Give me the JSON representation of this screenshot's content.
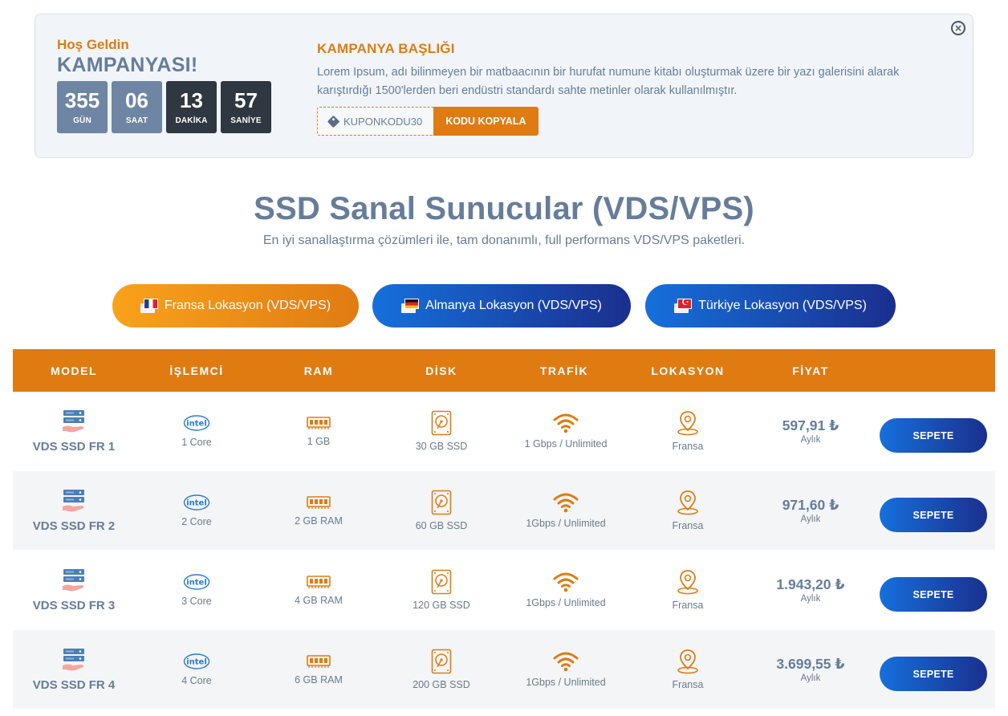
{
  "banner": {
    "hello": "Hoş Geldin",
    "campaign_word": "KAMPANYASI!",
    "countdown": [
      {
        "value": "355",
        "label": "GÜN"
      },
      {
        "value": "06",
        "label": "SAAT"
      },
      {
        "value": "13",
        "label": "DAKİKA"
      },
      {
        "value": "57",
        "label": "SANİYE"
      }
    ],
    "title": "KAMPANYA BAŞLIĞI",
    "description": "Lorem Ipsum, adı bilinmeyen bir matbaacının bir hurufat numune kitabı oluşturmak üzere bir yazı galerisini alarak karıştırdığı 1500'lerden beri endüstri standardı sahte metinler olarak kullanılmıştır.",
    "coupon_code": "KUPONKODU30",
    "copy_button": "KODU KOPYALA",
    "close_glyph": "×"
  },
  "heading": {
    "title": "SSD Sanal Sunucular (VDS/VPS)",
    "subtitle": "En iyi sanallaştırma çözümleri ile, tam donanımlı, full performans VDS/VPS paketleri."
  },
  "tabs": [
    {
      "label": "Fransa Lokasyon (VDS/VPS)",
      "active": true
    },
    {
      "label": "Almanya Lokasyon (VDS/VPS)",
      "active": false
    },
    {
      "label": "Türkiye Lokasyon (VDS/VPS)",
      "active": false
    }
  ],
  "table": {
    "headers": [
      "MODEL",
      "İŞLEMCİ",
      "RAM",
      "DİSK",
      "TRAFİK",
      "LOKASYON",
      "FİYAT"
    ],
    "rows": [
      {
        "model": "VDS SSD FR 1",
        "cpu": "1 Core",
        "ram": "1 GB",
        "disk": "30 GB SSD",
        "traffic": "1 Gbps / Unlimited",
        "location": "Fransa",
        "price": "597,91 ₺",
        "period": "Aylık",
        "button": "SEPETE"
      },
      {
        "model": "VDS SSD FR 2",
        "cpu": "2 Core",
        "ram": "2 GB RAM",
        "disk": "60 GB SSD",
        "traffic": "1Gbps / Unlimited",
        "location": "Fransa",
        "price": "971,60 ₺",
        "period": "Aylık",
        "button": "SEPETE"
      },
      {
        "model": "VDS SSD FR 3",
        "cpu": "3 Core",
        "ram": "4 GB RAM",
        "disk": "120 GB SSD",
        "traffic": "1Gbps / Unlimited",
        "location": "Fransa",
        "price": "1.943,20 ₺",
        "period": "Aylık",
        "button": "SEPETE"
      },
      {
        "model": "VDS SSD FR 4",
        "cpu": "4 Core",
        "ram": "6 GB RAM",
        "disk": "200 GB SSD",
        "traffic": "1Gbps / Unlimited",
        "location": "Fransa",
        "price": "3.699,55 ₺",
        "period": "Aylık",
        "button": "SEPETE"
      }
    ],
    "icons": {
      "model": "server-icon",
      "cpu": "intel-icon",
      "ram": "ram-icon",
      "disk": "hard-disk-icon",
      "traffic": "wifi-icon",
      "location": "location-pin-icon"
    }
  },
  "colors": {
    "accent_orange": "#e07b12",
    "text_slate": "#667d9a",
    "button_blue_start": "#1670dc",
    "button_blue_end": "#1a2f8e",
    "countdown_light": "#6e85a3",
    "countdown_dark": "#2f3740"
  }
}
